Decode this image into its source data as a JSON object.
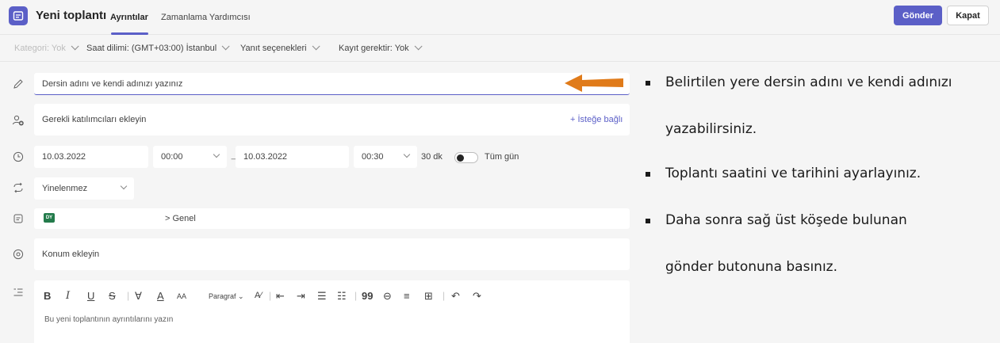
{
  "header": {
    "title": "Yeni toplantı",
    "tabs": [
      {
        "label": "Ayrıntılar",
        "active": true
      },
      {
        "label": "Zamanlama Yardımcısı",
        "active": false
      }
    ],
    "send_label": "Gönder",
    "close_label": "Kapat",
    "accent_color": "#5b5fc7"
  },
  "options": {
    "category": "Kategori: Yok",
    "timezone": "Saat dilimi: (GMT+03:00) İstanbul",
    "response": "Yanıt seçenekleri",
    "recording": "Kayıt gerektir: Yok"
  },
  "form": {
    "title_placeholder": "Dersin adını ve kendi adınızı yazınız",
    "attendees_placeholder": "Gerekli katılımcıları ekleyin",
    "optional_link": "+ İsteğe bağlı",
    "start_date": "10.03.2022",
    "start_time": "00:00",
    "end_date": "10.03.2022",
    "end_time": "00:30",
    "duration": "30 dk",
    "all_day_label": "Tüm gün",
    "repeat": "Yinelenmez",
    "channel_badge": "DY",
    "channel_path": "> Genel",
    "location_placeholder": "Konum ekleyin",
    "editor_style_label": "Paragraf",
    "details_placeholder": "Bu yeni toplantının ayrıntılarını yazın"
  },
  "annotations": {
    "arrow_color": "#e07b1a",
    "bullets": [
      {
        "line1": "Belirtilen yere dersin adını ve kendi adınızı",
        "line2": "yazabilirsiniz."
      },
      {
        "line1": "Toplantı saatini ve tarihini ayarlayınız.",
        "line2": ""
      },
      {
        "line1": "Daha sonra sağ üst köşede bulunan",
        "line2": "gönder butonuna basınız."
      }
    ]
  }
}
